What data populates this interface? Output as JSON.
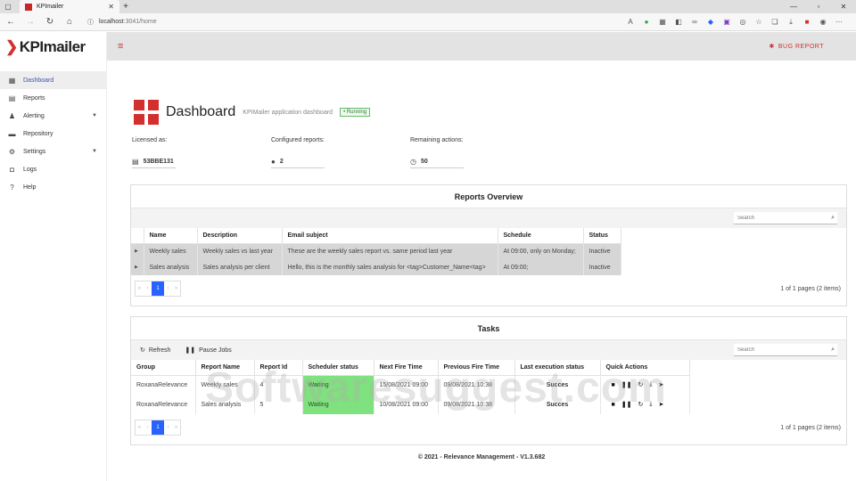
{
  "browser": {
    "tab_title": "KPImailer",
    "url_host": "localhost",
    "url_rest": ":3041/home"
  },
  "sidebar": {
    "logo_text": "KPImailer",
    "items": [
      {
        "label": "Dashboard",
        "icon": "dashboard-icon"
      },
      {
        "label": "Reports",
        "icon": "reports-icon"
      },
      {
        "label": "Alerting",
        "icon": "bell-icon"
      },
      {
        "label": "Repository",
        "icon": "folder-icon"
      },
      {
        "label": "Settings",
        "icon": "gear-icon"
      },
      {
        "label": "Logs",
        "icon": "logs-icon"
      },
      {
        "label": "Help",
        "icon": "help-icon"
      }
    ]
  },
  "topbar": {
    "bug_report": "BUG REPORT"
  },
  "dashboard": {
    "title": "Dashboard",
    "subtitle": "KPIMailer application dashboard",
    "status": "• Running"
  },
  "stats": {
    "licensed_label": "Licensed as:",
    "licensed_value": "53BBE131",
    "configured_label": "Configured reports:",
    "configured_value": "2",
    "remaining_label": "Remaining actions:",
    "remaining_value": "50"
  },
  "reports_overview": {
    "title": "Reports Overview",
    "search_placeholder": "Search",
    "columns": [
      "Name",
      "Description",
      "Email subject",
      "Schedule",
      "Status"
    ],
    "rows": [
      {
        "name": "Weekly sales",
        "description": "Weekly sales vs last year",
        "subject": "These are the weekly sales report vs. same period last year",
        "schedule": "At 09:00, only on Monday;",
        "status": "Inactive"
      },
      {
        "name": "Sales analysis",
        "description": "Sales analysis per client",
        "subject": "Hello, this is the monthly sales analysis for <tag>Customer_Name<tag>",
        "schedule": "At 09:00;",
        "status": "Inactive"
      }
    ],
    "page": "1",
    "page_info": "1 of 1 pages (2 items)"
  },
  "tasks": {
    "title": "Tasks",
    "refresh": "Refresh",
    "pause": "Pause Jobs",
    "search_placeholder": "Search",
    "columns": [
      "Group",
      "Report Name",
      "Report Id",
      "Scheduler status",
      "Next Fire Time",
      "Previous Fire Time",
      "Last execution status",
      "Quick Actions"
    ],
    "rows": [
      {
        "group": "RoxanaRelevance",
        "report": "Weekly sales",
        "id": "4",
        "status": "Waiting",
        "next": "15/08/2021 09:00",
        "prev": "09/08/2021 10:38",
        "last": "Succes"
      },
      {
        "group": "RoxanaRelevance",
        "report": "Sales analysis",
        "id": "5",
        "status": "Waiting",
        "next": "10/08/2021 09:00",
        "prev": "09/08/2021 10:38",
        "last": "Succes"
      }
    ],
    "page": "1",
    "page_info": "1 of 1 pages (2 items)"
  },
  "footer": "© 2021 - Relevance Management - V1.3.682",
  "watermark": "Softwaresuggest.com",
  "colors": {
    "accent": "#d32f2f",
    "active_nav": "#3a54b4",
    "waiting": "#80e27e",
    "pager": "#2962ff"
  }
}
